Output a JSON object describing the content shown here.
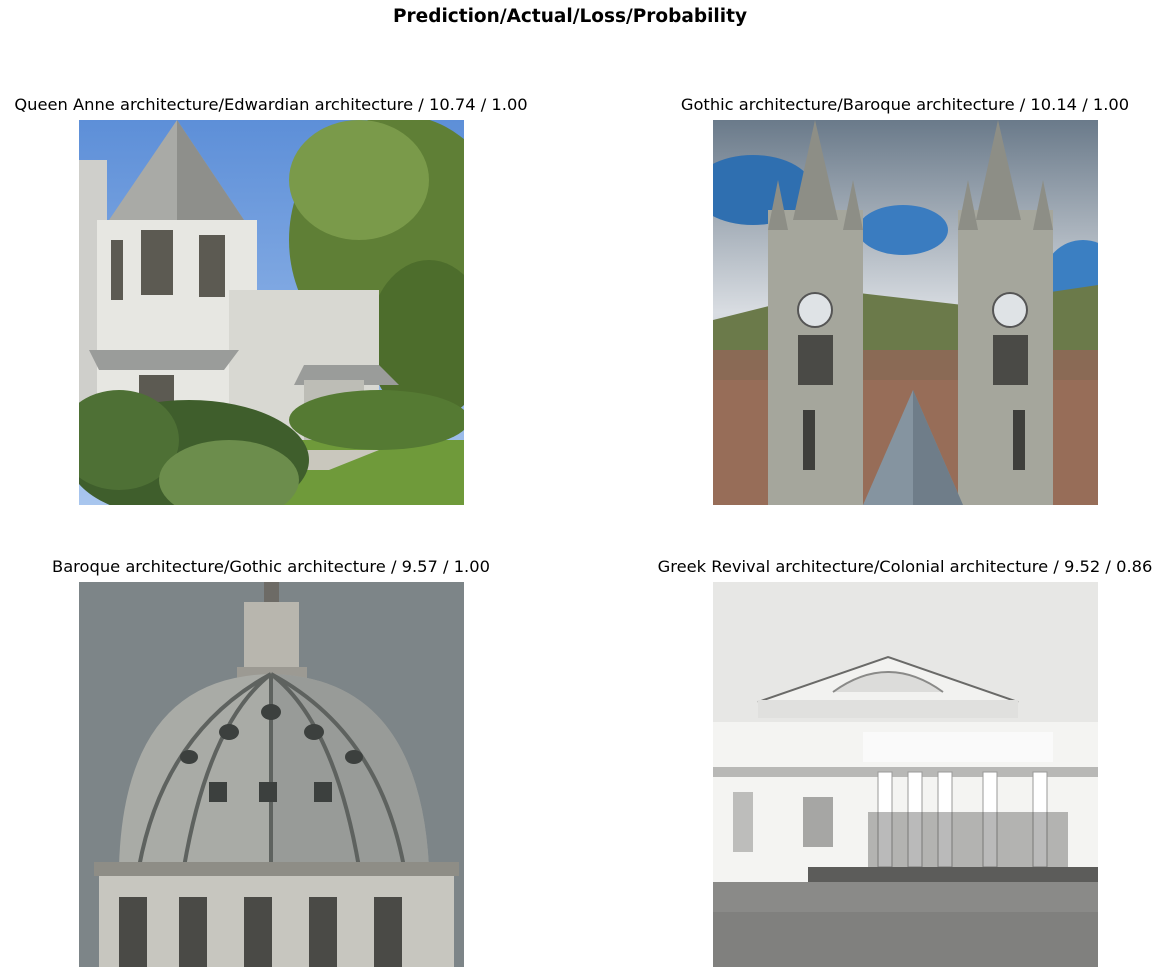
{
  "figure": {
    "suptitle": "Prediction/Actual/Loss/Probability"
  },
  "panels": [
    {
      "title": "Queen Anne architecture/Edwardian architecture / 10.74 / 1.00"
    },
    {
      "title": "Gothic architecture/Baroque architecture / 10.14 / 1.00"
    },
    {
      "title": "Baroque architecture/Gothic architecture / 9.57 / 1.00"
    },
    {
      "title": "Greek Revival architecture/Colonial architecture / 9.52 / 0.86"
    }
  ]
}
